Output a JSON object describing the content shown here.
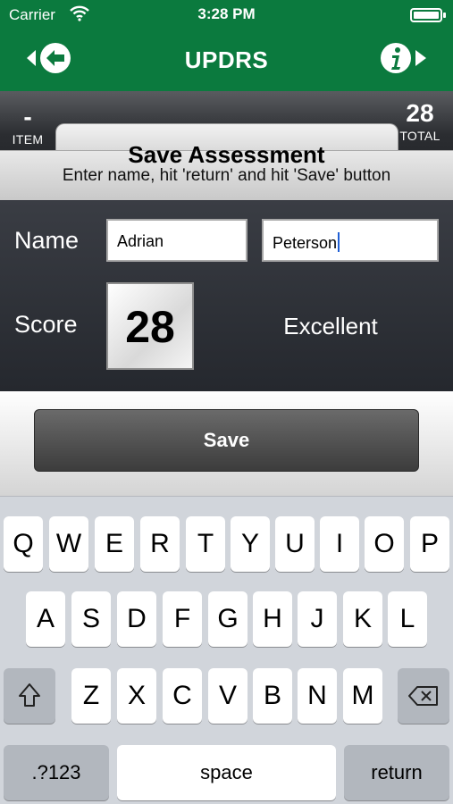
{
  "status_bar": {
    "carrier": "Carrier",
    "time": "3:28 PM"
  },
  "nav": {
    "title": "UPDRS"
  },
  "header": {
    "item_value": "-",
    "item_label": "ITEM",
    "total_value": "28",
    "total_label": "TOTAL"
  },
  "panel": {
    "title": "Save Assessment",
    "subtitle": "Enter name, hit 'return' and hit 'Save' button"
  },
  "form": {
    "name_label": "Name",
    "first_name": "Adrian",
    "last_name": "Peterson",
    "score_label": "Score",
    "score": "28",
    "rating": "Excellent"
  },
  "save_button": {
    "label": "Save"
  },
  "keyboard": {
    "row1": [
      "Q",
      "W",
      "E",
      "R",
      "T",
      "Y",
      "U",
      "I",
      "O",
      "P"
    ],
    "row2": [
      "A",
      "S",
      "D",
      "F",
      "G",
      "H",
      "J",
      "K",
      "L"
    ],
    "row3": [
      "Z",
      "X",
      "C",
      "V",
      "B",
      "N",
      "M"
    ],
    "numbers_key": ".?123",
    "space_key": "space",
    "return_key": "return"
  },
  "colors": {
    "nav_green": "#0b7a3e",
    "caret_blue": "#1f5fd6",
    "keyboard_bg": "#d1d5db"
  },
  "icons": {
    "nav_left": "back-arrow-icon",
    "nav_right": "info-icon",
    "shift": "shift-icon",
    "delete": "backspace-icon",
    "wifi": "wifi-icon",
    "battery": "battery-icon"
  }
}
